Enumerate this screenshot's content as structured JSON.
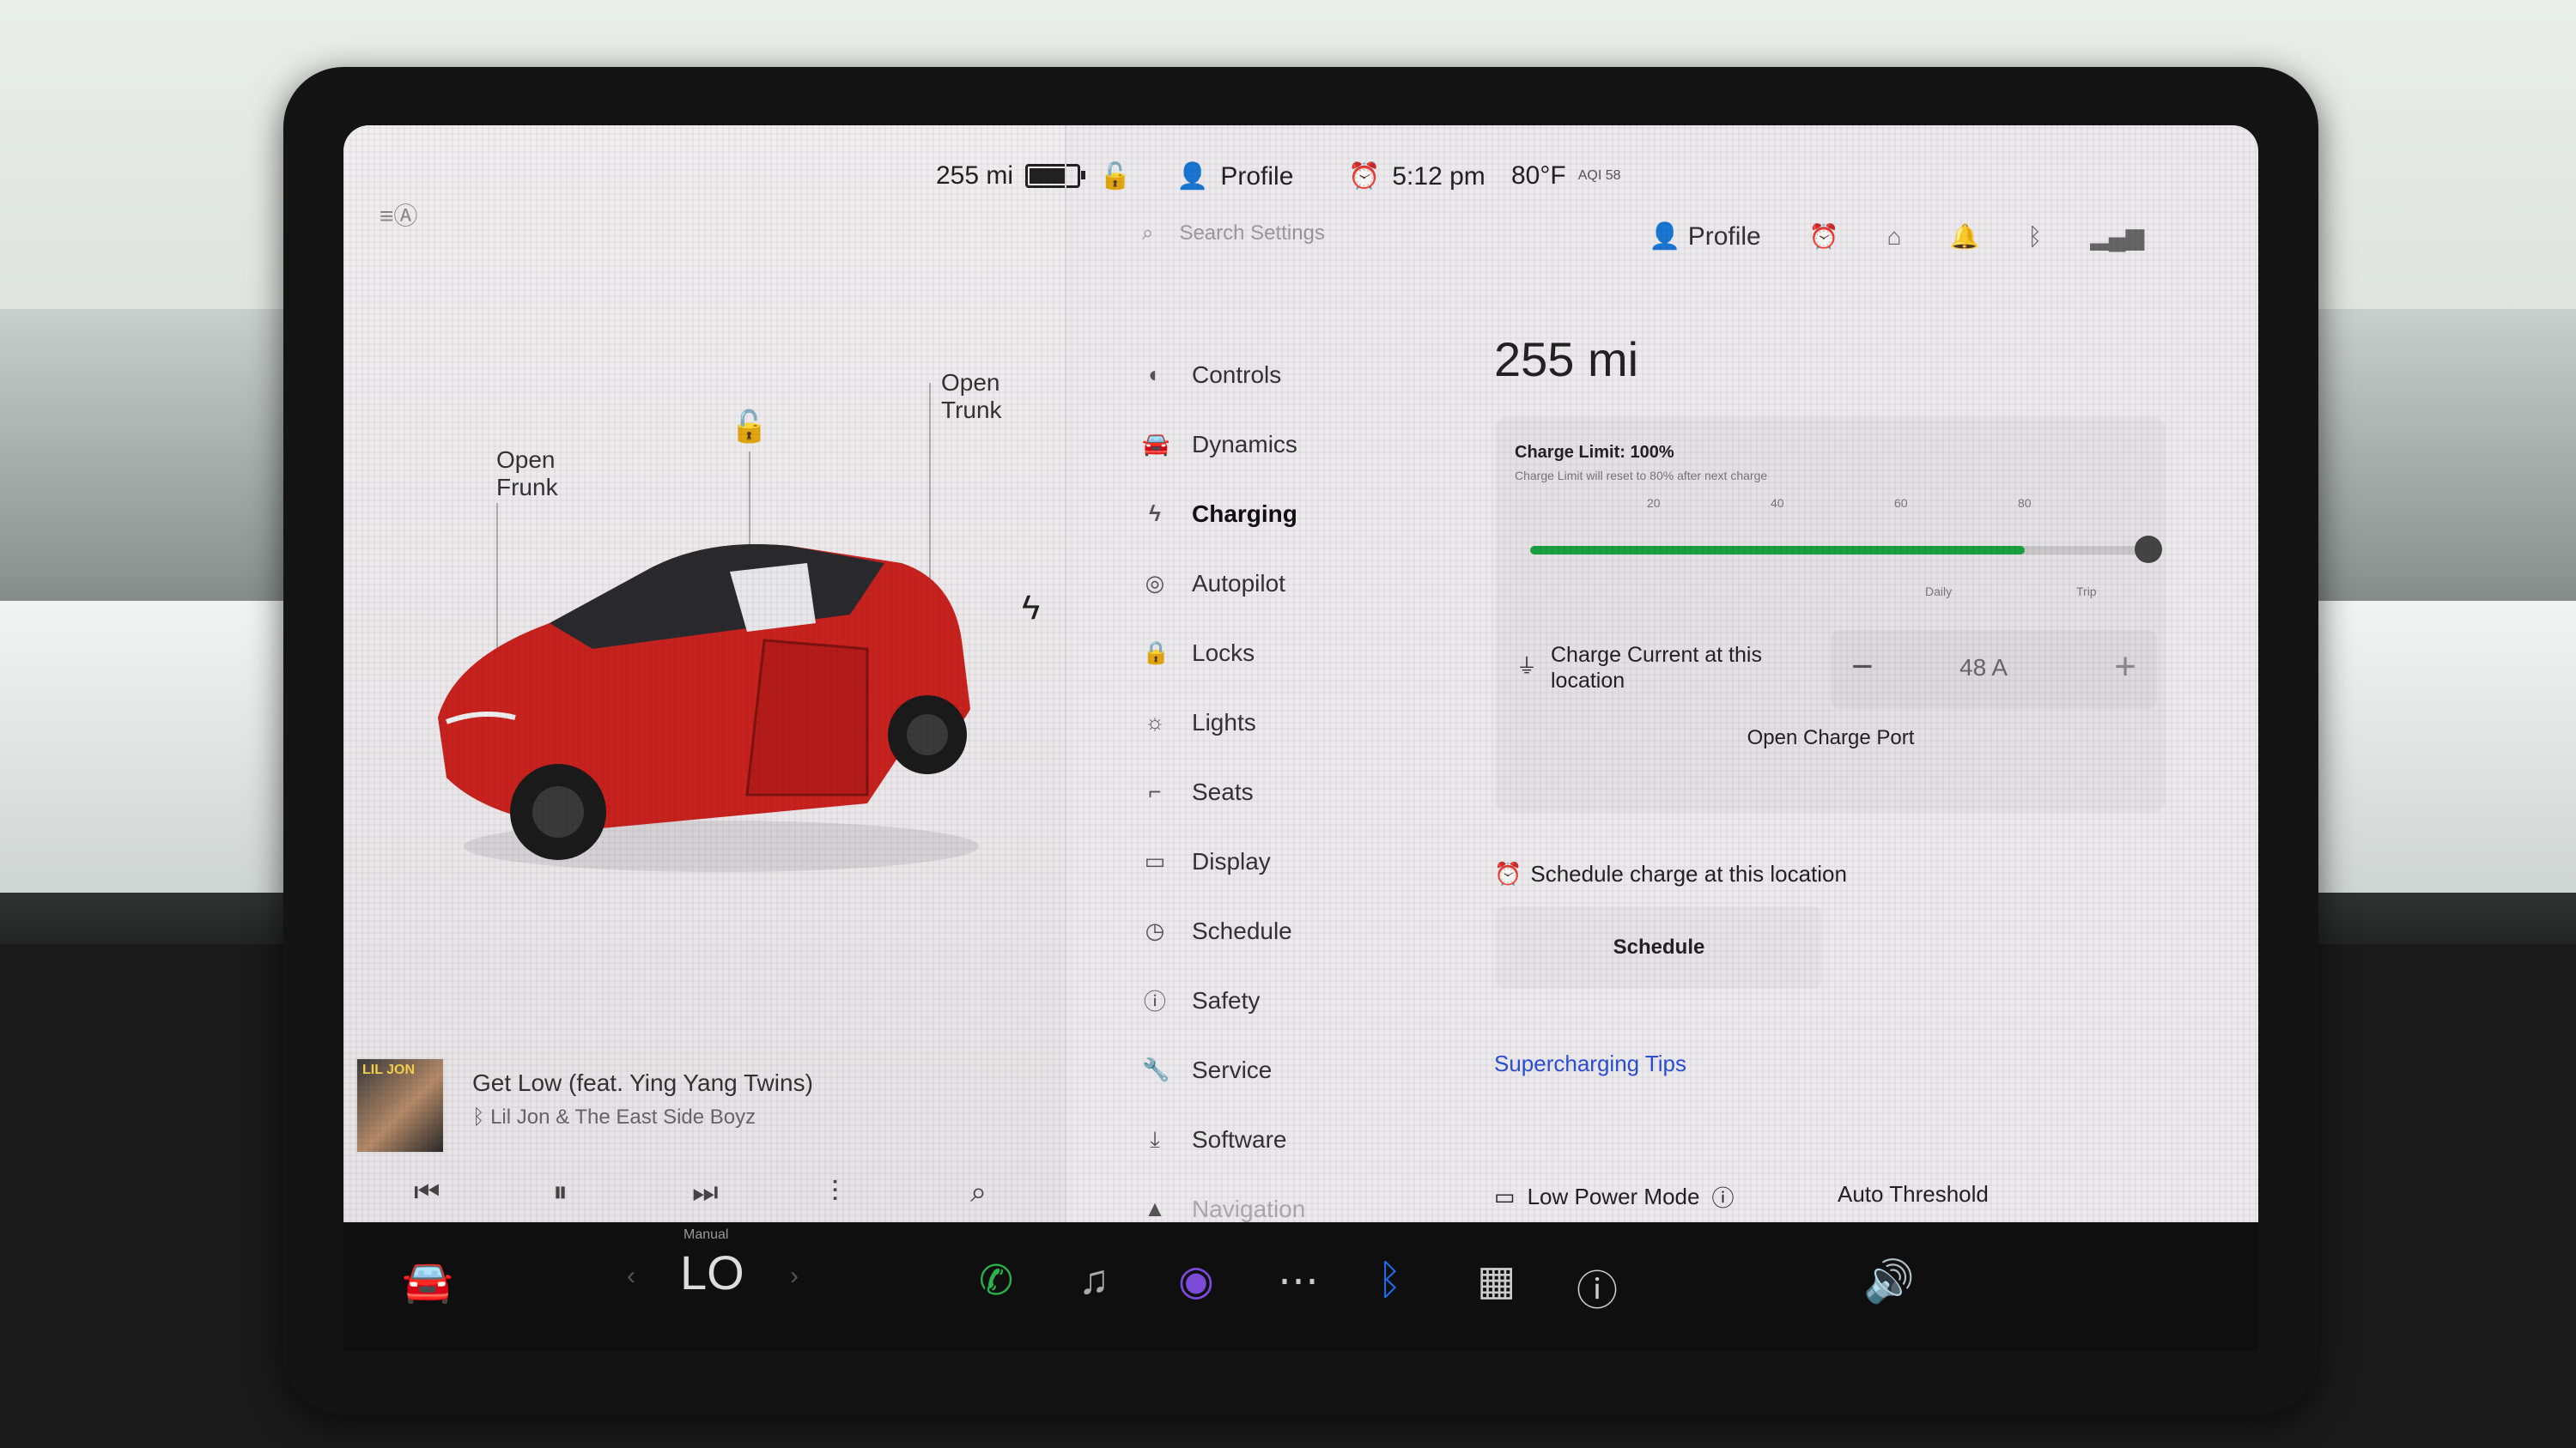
{
  "status_bar": {
    "range": "255 mi",
    "profile": "Profile",
    "time": "5:12 pm",
    "temperature": "80°F",
    "aqi": "AQI 58",
    "battery_level": 0.8
  },
  "vehicle": {
    "open_frunk": [
      "Open",
      "Frunk"
    ],
    "open_trunk": [
      "Open",
      "Trunk"
    ]
  },
  "media": {
    "album_text": "LIL JON",
    "song_title": "Get Low (feat. Ying Yang Twins)",
    "artist": "Lil Jon & The East Side Boyz"
  },
  "settings": {
    "search_placeholder": "Search Settings",
    "header_profile": "Profile",
    "menu": [
      {
        "label": "Controls",
        "icon": "toggle-icon"
      },
      {
        "label": "Dynamics",
        "icon": "car-icon"
      },
      {
        "label": "Charging",
        "icon": "bolt-icon"
      },
      {
        "label": "Autopilot",
        "icon": "steering-wheel-icon"
      },
      {
        "label": "Locks",
        "icon": "lock-icon"
      },
      {
        "label": "Lights",
        "icon": "light-icon"
      },
      {
        "label": "Seats",
        "icon": "seat-icon"
      },
      {
        "label": "Display",
        "icon": "display-icon"
      },
      {
        "label": "Schedule",
        "icon": "clock-icon"
      },
      {
        "label": "Safety",
        "icon": "info-icon"
      },
      {
        "label": "Service",
        "icon": "wrench-icon"
      },
      {
        "label": "Software",
        "icon": "download-icon"
      },
      {
        "label": "Navigation",
        "icon": "navigation-icon"
      }
    ],
    "active_item": "Charging"
  },
  "charging": {
    "range": "255 mi",
    "charge_limit_label": "Charge Limit: 100%",
    "charge_limit_note": "Charge Limit will reset to 80% after next charge",
    "charge_limit_value": 100,
    "battery_fill": 80,
    "tick_labels": [
      "20",
      "40",
      "60",
      "80"
    ],
    "daily_label": "Daily",
    "trip_label": "Trip",
    "charge_current_label": "Charge Current at this location",
    "charge_current_value": "48 A",
    "open_charge_port": "Open Charge Port",
    "schedule_label": "Schedule charge at this location",
    "schedule_button": "Schedule",
    "supercharging_tips": "Supercharging Tips",
    "low_power_mode": "Low Power Mode",
    "auto_threshold": "Auto Threshold"
  },
  "taskbar": {
    "manual_label": "Manual",
    "temp_display": "LO"
  },
  "colors": {
    "accent_green": "#1aa040",
    "link_blue": "#2a4fd6",
    "alarm_orange": "#e8943a",
    "phone_green": "#2bb24c",
    "bluetooth_blue": "#1e6ef0"
  }
}
